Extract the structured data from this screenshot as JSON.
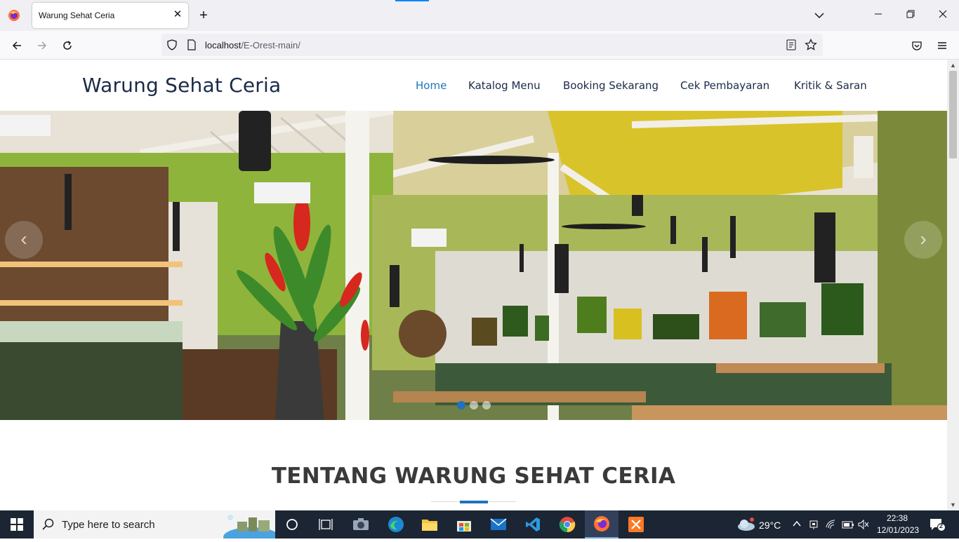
{
  "browser": {
    "tab_title": "Warung Sehat Ceria",
    "close_glyph": "✕",
    "new_tab_glyph": "+",
    "url_host": "localhost",
    "url_path": "/E-Orest-main/"
  },
  "site": {
    "title": "Warung Sehat Ceria",
    "menu": [
      {
        "label": "Home",
        "active": true
      },
      {
        "label": "Katalog Menu",
        "active": false
      },
      {
        "label": "Booking Sekarang",
        "active": false
      },
      {
        "label": "Cek Pembayaran",
        "active": false
      },
      {
        "label": "Kritik & Saran",
        "active": false
      }
    ],
    "carousel": {
      "prev_glyph": "‹",
      "next_glyph": "›",
      "slide_count": 3,
      "active_index": 0
    },
    "about_heading": "TENTANG WARUNG SEHAT CERIA"
  },
  "taskbar": {
    "search_placeholder": "Type here to search",
    "weather": "29°C",
    "time": "22:38",
    "date": "12/01/2023",
    "notification_count": "2"
  },
  "colors": {
    "accent": "#1e73be",
    "brand_text": "#1b2a4a",
    "taskbar": "#1c2533"
  }
}
